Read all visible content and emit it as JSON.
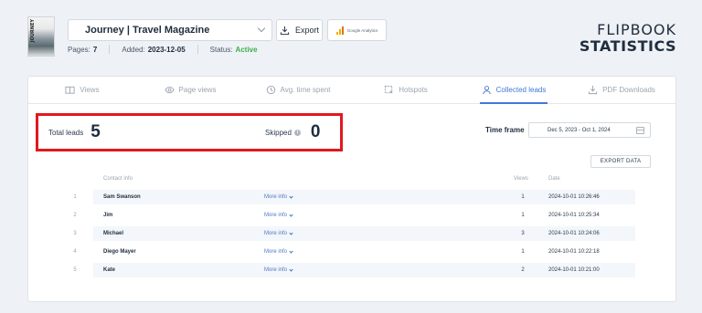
{
  "magazine": {
    "cover_label": "JOURNEY",
    "title": "Journey | Travel Magazine",
    "pages_label": "Pages:",
    "pages": "7",
    "added_label": "Added:",
    "added": "2023-12-05",
    "status_label": "Status:",
    "status": "Active"
  },
  "toolbar": {
    "export_label": "Export",
    "ga_label": "Google Analytics"
  },
  "brand": {
    "line1": "FLIPBOOK",
    "line2": "STATISTICS"
  },
  "tabs": [
    {
      "label": "Views",
      "icon": "book-icon"
    },
    {
      "label": "Page views",
      "icon": "eye-icon"
    },
    {
      "label": "Avg. time spent",
      "icon": "clock-icon"
    },
    {
      "label": "Hotspots",
      "icon": "hotspot-icon"
    },
    {
      "label": "Collected leads",
      "icon": "user-icon",
      "active": true
    },
    {
      "label": "PDF Downloads",
      "icon": "download-icon"
    }
  ],
  "stats": {
    "total_label": "Total leads",
    "total": "5",
    "skipped_label": "Skipped",
    "skipped": "0"
  },
  "timeframe": {
    "label": "Time frame",
    "value": "Dec 5, 2023 - Oct 1, 2024"
  },
  "export_data_label": "EXPORT DATA",
  "table": {
    "headers": {
      "contact": "Contact info",
      "views": "Views",
      "date": "Date"
    },
    "more_label": "More info",
    "rows": [
      {
        "n": "1",
        "name": "Sam Swanson",
        "views": "1",
        "date": "2024-10-01 10:26:46"
      },
      {
        "n": "2",
        "name": "Jim",
        "views": "1",
        "date": "2024-10-01 10:25:34"
      },
      {
        "n": "3",
        "name": "Michael",
        "views": "3",
        "date": "2024-10-01 10:24:06"
      },
      {
        "n": "4",
        "name": "Diego Mayer",
        "views": "1",
        "date": "2024-10-01 10:22:18"
      },
      {
        "n": "5",
        "name": "Kate",
        "views": "2",
        "date": "2024-10-01 10:21:00"
      }
    ]
  },
  "colors": {
    "accent": "#3e79d8",
    "active_status": "#3fae48",
    "highlight_box": "#e0181f"
  }
}
